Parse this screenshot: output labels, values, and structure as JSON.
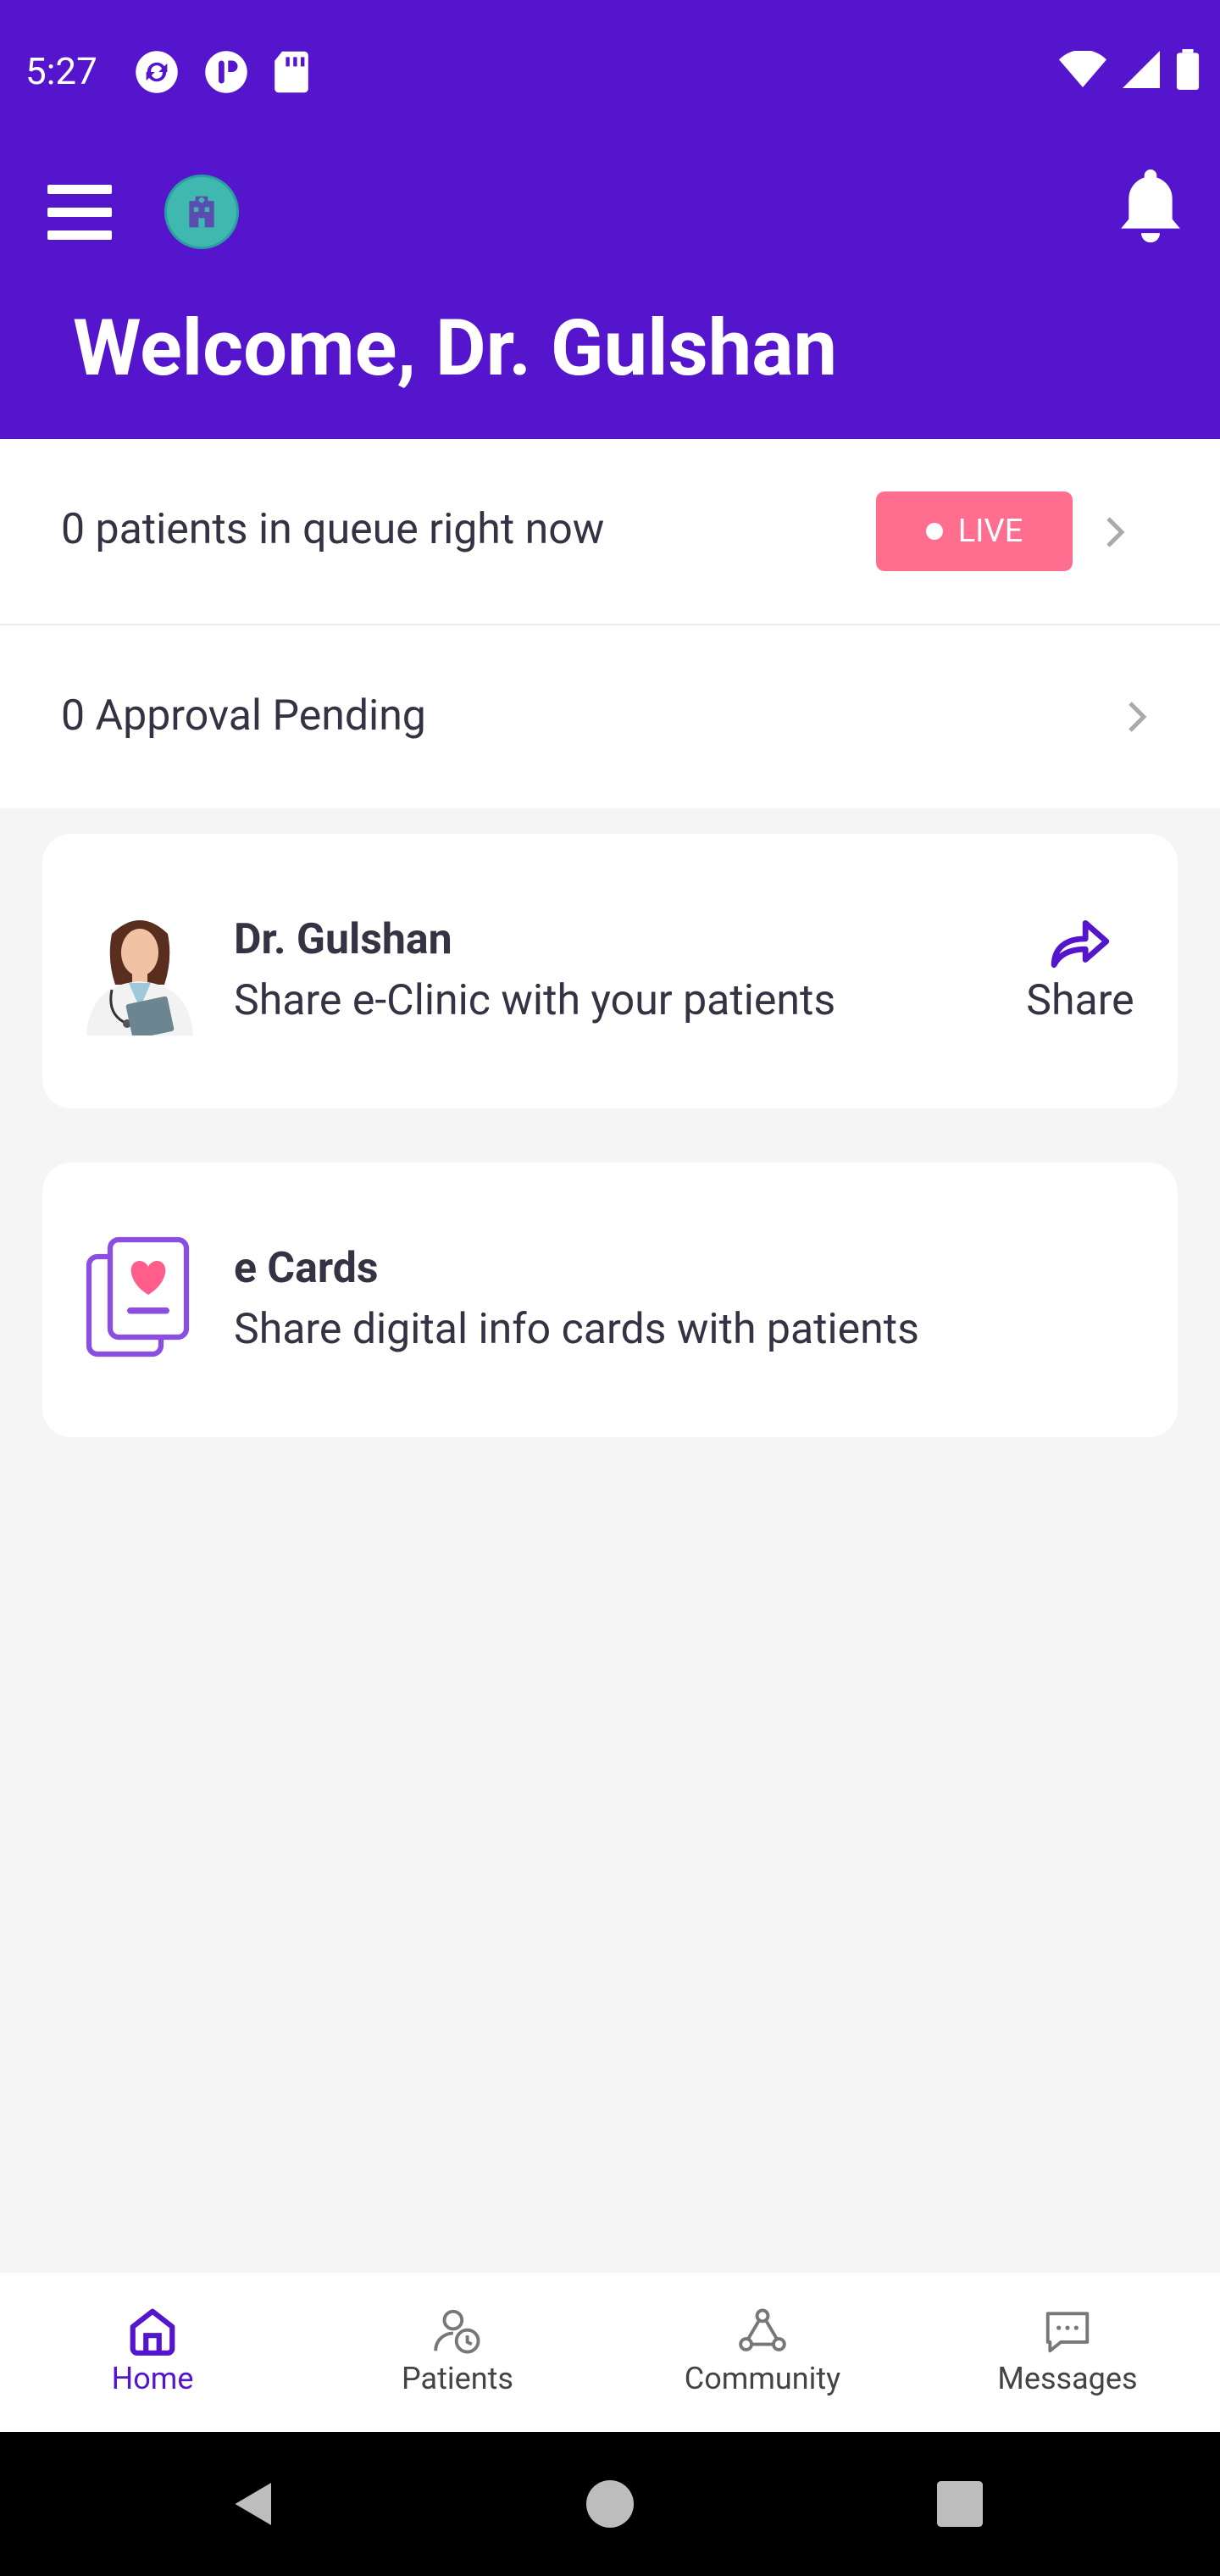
{
  "status_bar": {
    "time": "5:27"
  },
  "header": {
    "welcome": "Welcome, Dr. Gulshan",
    "brand_color": "#5515cc"
  },
  "queue_row": {
    "label": "0 patients in queue right now",
    "badge": "LIVE",
    "badge_color": "#ff6e8f"
  },
  "approval_row": {
    "label": "0 Approval Pending"
  },
  "share_card": {
    "title": "Dr. Gulshan",
    "subtitle": "Share e-Clinic with your patients",
    "action_label": "Share"
  },
  "ecards_card": {
    "title": "e Cards",
    "subtitle": "Share digital info cards with patients"
  },
  "bottom_nav": {
    "items": [
      {
        "label": "Home",
        "icon": "home-icon",
        "active": true
      },
      {
        "label": "Patients",
        "icon": "patients-icon",
        "active": false
      },
      {
        "label": "Community",
        "icon": "community-icon",
        "active": false
      },
      {
        "label": "Messages",
        "icon": "messages-icon",
        "active": false
      }
    ]
  }
}
